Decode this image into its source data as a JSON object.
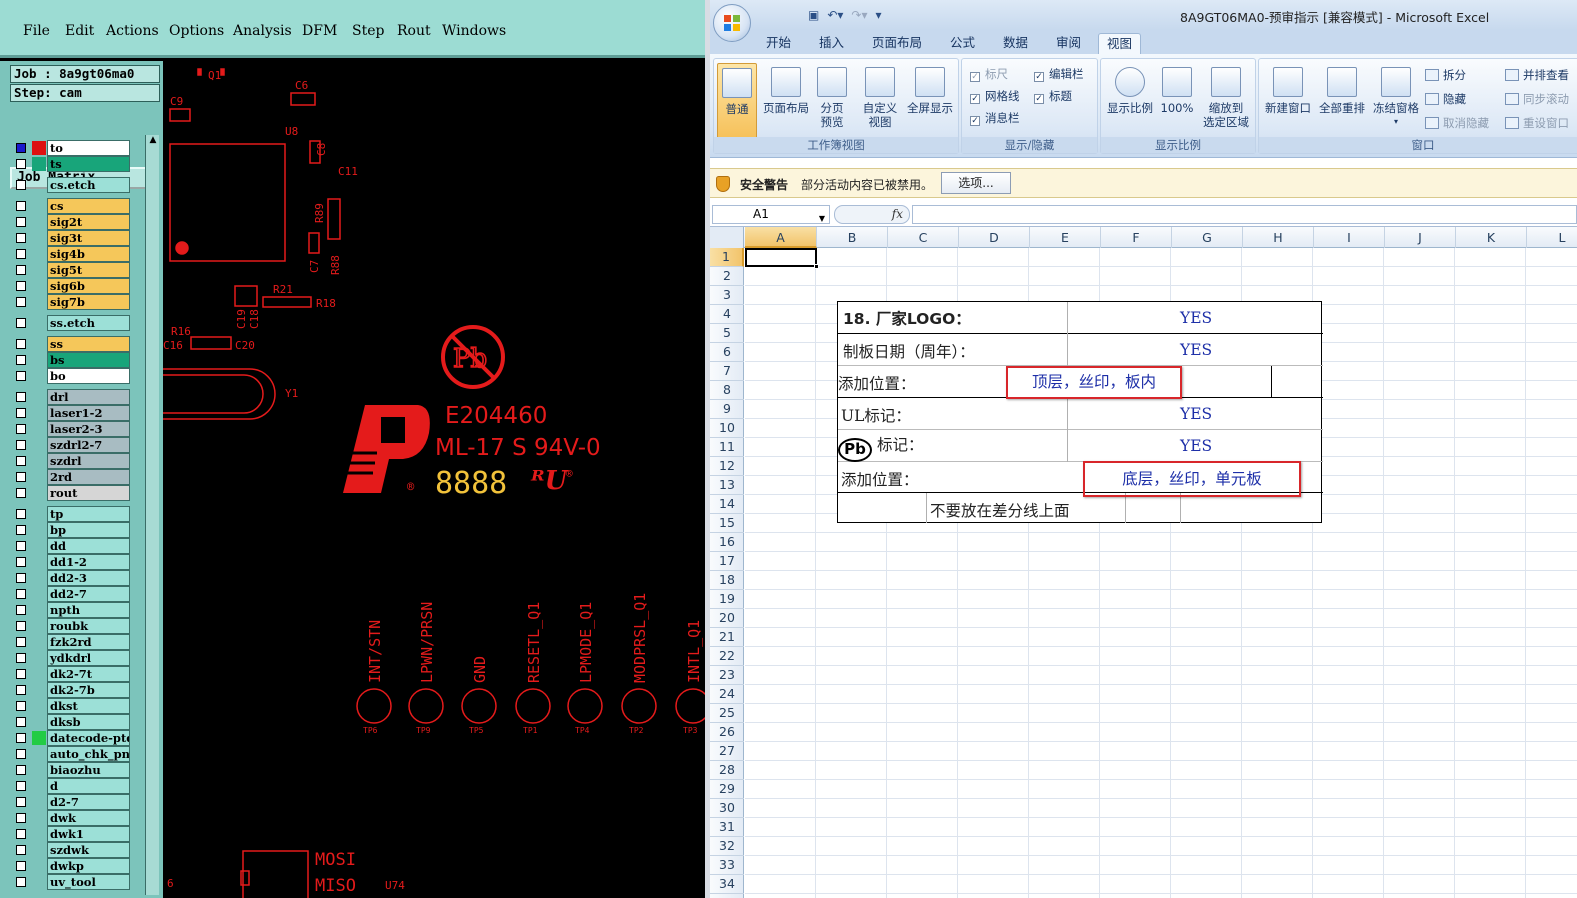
{
  "cam": {
    "menu": [
      "File",
      "Edit",
      "Actions",
      "Options",
      "Analysis",
      "DFM",
      "Step",
      "Rout",
      "Windows"
    ],
    "job_label": "Job : 8a9gt06ma0",
    "step_label": "Step: cam",
    "job_matrix_label": "Job Matrix ...",
    "layers": [
      {
        "name": "to",
        "bg": "#ffffff",
        "sw": "#dd1111",
        "checked": true
      },
      {
        "name": "ts",
        "bg": "#18a57a",
        "sw": "#18a57a",
        "checked": false
      },
      {
        "name": "cs.etch",
        "bg": "#9ce0d7",
        "sw": "",
        "checked": false
      },
      {
        "name": "cs",
        "bg": "#f5c75a",
        "sw": "",
        "checked": false
      },
      {
        "name": "sig2t",
        "bg": "#f5c75a",
        "sw": "",
        "checked": false
      },
      {
        "name": "sig3t",
        "bg": "#f5c75a",
        "sw": "",
        "checked": false
      },
      {
        "name": "sig4b",
        "bg": "#f5c75a",
        "sw": "",
        "checked": false
      },
      {
        "name": "sig5t",
        "bg": "#f5c75a",
        "sw": "",
        "checked": false
      },
      {
        "name": "sig6b",
        "bg": "#f5c75a",
        "sw": "",
        "checked": false
      },
      {
        "name": "sig7b",
        "bg": "#f5c75a",
        "sw": "",
        "checked": false
      },
      {
        "name": "ss.etch",
        "bg": "#9ce0d7",
        "sw": "",
        "checked": false
      },
      {
        "name": "ss",
        "bg": "#f5c75a",
        "sw": "",
        "checked": false
      },
      {
        "name": "bs",
        "bg": "#18a57a",
        "sw": "",
        "checked": false
      },
      {
        "name": "bo",
        "bg": "#ffffff",
        "sw": "",
        "checked": false
      },
      {
        "name": "drl",
        "bg": "#a8bcc2",
        "sw": "",
        "checked": false
      },
      {
        "name": "laser1-2",
        "bg": "#a8bcc2",
        "sw": "",
        "checked": false
      },
      {
        "name": "laser2-3",
        "bg": "#a8bcc2",
        "sw": "",
        "checked": false
      },
      {
        "name": "szdrl2-7",
        "bg": "#a8bcc2",
        "sw": "",
        "checked": false
      },
      {
        "name": "szdrl",
        "bg": "#a8bcc2",
        "sw": "",
        "checked": false
      },
      {
        "name": "2rd",
        "bg": "#a8bcc2",
        "sw": "",
        "checked": false
      },
      {
        "name": "rout",
        "bg": "#d6d6d6",
        "sw": "",
        "checked": false
      },
      {
        "name": "tp",
        "bg": "#9ce0d7",
        "sw": "",
        "checked": false
      },
      {
        "name": "bp",
        "bg": "#9ce0d7",
        "sw": "",
        "checked": false
      },
      {
        "name": "dd",
        "bg": "#9ce0d7",
        "sw": "",
        "checked": false
      },
      {
        "name": "dd1-2",
        "bg": "#9ce0d7",
        "sw": "",
        "checked": false
      },
      {
        "name": "dd2-3",
        "bg": "#9ce0d7",
        "sw": "",
        "checked": false
      },
      {
        "name": "dd2-7",
        "bg": "#9ce0d7",
        "sw": "",
        "checked": false
      },
      {
        "name": "npth",
        "bg": "#9ce0d7",
        "sw": "",
        "checked": false
      },
      {
        "name": "roubk",
        "bg": "#9ce0d7",
        "sw": "",
        "checked": false
      },
      {
        "name": "fzk2rd",
        "bg": "#9ce0d7",
        "sw": "",
        "checked": false
      },
      {
        "name": "ydkdrl",
        "bg": "#9ce0d7",
        "sw": "",
        "checked": false
      },
      {
        "name": "dk2-7t",
        "bg": "#9ce0d7",
        "sw": "",
        "checked": false
      },
      {
        "name": "dk2-7b",
        "bg": "#9ce0d7",
        "sw": "",
        "checked": false
      },
      {
        "name": "dkst",
        "bg": "#9ce0d7",
        "sw": "",
        "checked": false
      },
      {
        "name": "dksb",
        "bg": "#9ce0d7",
        "sw": "",
        "checked": false
      },
      {
        "name": "datecode-ptd",
        "bg": "#9ce0d7",
        "sw": "#22cc44",
        "checked": false
      },
      {
        "name": "auto_chk_pnl",
        "bg": "#9ce0d7",
        "sw": "",
        "checked": false
      },
      {
        "name": "biaozhu",
        "bg": "#9ce0d7",
        "sw": "",
        "checked": false
      },
      {
        "name": "d",
        "bg": "#9ce0d7",
        "sw": "",
        "checked": false
      },
      {
        "name": "d2-7",
        "bg": "#9ce0d7",
        "sw": "",
        "checked": false
      },
      {
        "name": "dwk",
        "bg": "#9ce0d7",
        "sw": "",
        "checked": false
      },
      {
        "name": "dwk1",
        "bg": "#9ce0d7",
        "sw": "",
        "checked": false
      },
      {
        "name": "szdwk",
        "bg": "#9ce0d7",
        "sw": "",
        "checked": false
      },
      {
        "name": "dwkp",
        "bg": "#9ce0d7",
        "sw": "",
        "checked": false
      },
      {
        "name": "uv_tool",
        "bg": "#9ce0d7",
        "sw": "",
        "checked": false
      }
    ],
    "silk": {
      "ul_number": "E204460",
      "ul_grade": "ML-17 S 94V-0",
      "datecode": "8888",
      "components": [
        "Q1",
        "C6",
        "C9",
        "U8",
        "C8",
        "C11",
        "R89",
        "C7",
        "R88",
        "R21",
        "R18",
        "R16",
        "C16",
        "C20",
        "C19",
        "C18",
        "Y1",
        "U74"
      ],
      "pin_labels": [
        "INT/STN",
        "LPWN/PRSN",
        "GND",
        "RESETL_Q1",
        "LPMODE_Q1",
        "MODPRSL_Q1",
        "INTL_Q1"
      ],
      "tp_labels": [
        "TP6",
        "TP9",
        "TP5",
        "TP1",
        "TP4",
        "TP2",
        "TP3"
      ],
      "bottom_labels": [
        "MOSI",
        "MISO",
        "6"
      ]
    }
  },
  "excel": {
    "window_title": "8A9GT06MA0-预审指示 [兼容模式] - Microsoft Excel",
    "tabs": [
      "开始",
      "插入",
      "页面布局",
      "公式",
      "数据",
      "审阅",
      "视图"
    ],
    "active_tab": "视图",
    "groups": {
      "workbook_views": {
        "label": "工作簿视图",
        "buttons": [
          "普通",
          "页面布局",
          "分页\n预览",
          "自定义\n视图",
          "全屏显示"
        ]
      },
      "show_hide": {
        "label": "显示/隐藏",
        "items": [
          {
            "t": "标尺",
            "c": true,
            "d": true
          },
          {
            "t": "编辑栏",
            "c": true,
            "d": false
          },
          {
            "t": "网格线",
            "c": true,
            "d": false
          },
          {
            "t": "标题",
            "c": true,
            "d": false
          },
          {
            "t": "消息栏",
            "c": true,
            "d": false
          }
        ]
      },
      "zoom": {
        "label": "显示比例",
        "buttons": [
          "显示比例",
          "100%",
          "缩放到\n选定区域"
        ]
      },
      "window": {
        "label": "窗口",
        "buttons": [
          "新建窗口",
          "全部重排",
          "冻结窗格"
        ],
        "small": [
          "拆分",
          "隐藏",
          "取消隐藏"
        ],
        "small2": [
          "并排查看",
          "同步滚动",
          "重设窗口"
        ]
      }
    },
    "security": {
      "title": "安全警告",
      "message": "部分活动内容已被禁用。",
      "button": "选项..."
    },
    "name_box": "A1",
    "fx": "fx",
    "columns": [
      "A",
      "B",
      "C",
      "D",
      "E",
      "F",
      "G",
      "H",
      "I",
      "J",
      "K",
      "L"
    ],
    "rows": [
      "1",
      "2",
      "3",
      "4",
      "5",
      "6",
      "7",
      "8",
      "9",
      "10",
      "11",
      "12",
      "13",
      "14",
      "15",
      "16",
      "17",
      "18",
      "19",
      "20",
      "21",
      "22",
      "23",
      "24",
      "25",
      "26",
      "27",
      "28",
      "29",
      "30",
      "31",
      "32",
      "33",
      "34"
    ],
    "table": {
      "r1_label": "18. 厂家LOGO：",
      "r1_value": "YES",
      "r2_label": "制板日期（周年）：",
      "r2_value": "YES",
      "r3_label": "添加位置：",
      "r3_value": "顶层，丝印，板内",
      "r4_label": "UL标记：",
      "r4_value": "YES",
      "r5_icon": "Pb",
      "r5_label": "标记：",
      "r5_value": "YES",
      "r6_label": "添加位置：",
      "r6_value": "底层，丝印，单元板",
      "r7_note": "不要放在差分线上面"
    }
  }
}
